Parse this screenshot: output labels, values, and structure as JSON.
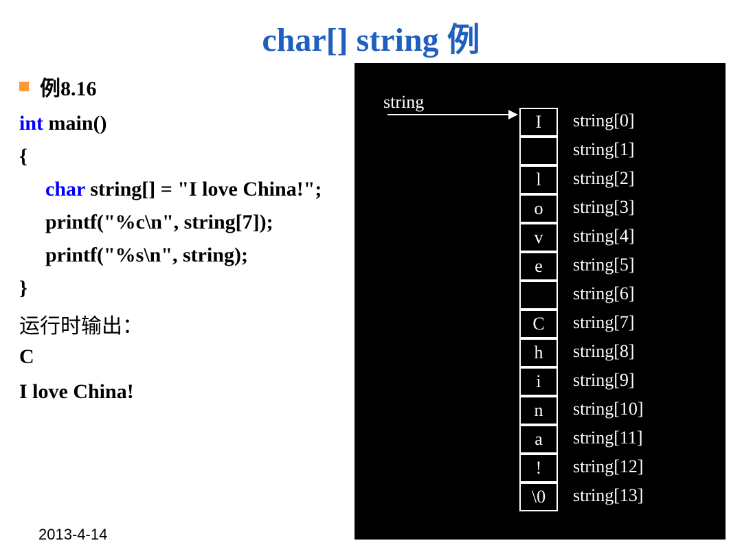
{
  "title": "char[] string 例",
  "bullet": "例8.16",
  "code": {
    "l1_kw": "int",
    "l1_rest": " main()",
    "l2": "{",
    "l3_kw": "char",
    "l3_rest": " string[] = \"I love China!\";",
    "l4": "printf(\"%c\\n\", string[7]);",
    "l5": "printf(\"%s\\n\", string);",
    "l6": "}"
  },
  "output_label": "运行时输出：",
  "output_line1": "C",
  "output_line2": "I love China!",
  "footer_date": "2013-4-14",
  "diagram": {
    "header": "string",
    "cells": [
      {
        "char": "I",
        "label": "string[0]"
      },
      {
        "char": " ",
        "label": "string[1]"
      },
      {
        "char": "l",
        "label": "string[2]"
      },
      {
        "char": "o",
        "label": "string[3]"
      },
      {
        "char": "v",
        "label": "string[4]"
      },
      {
        "char": "e",
        "label": "string[5]"
      },
      {
        "char": " ",
        "label": "string[6]"
      },
      {
        "char": "C",
        "label": "string[7]"
      },
      {
        "char": "h",
        "label": "string[8]"
      },
      {
        "char": "i",
        "label": "string[9]"
      },
      {
        "char": "n",
        "label": "string[10]"
      },
      {
        "char": "a",
        "label": "string[11]"
      },
      {
        "char": "!",
        "label": "string[12]"
      },
      {
        "char": "\\0",
        "label": "string[13]"
      }
    ]
  }
}
